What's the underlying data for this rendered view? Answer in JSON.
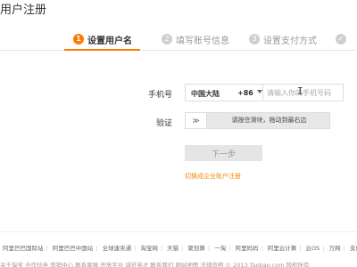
{
  "header": {
    "title": "用户注册"
  },
  "steps": [
    {
      "num": "1",
      "label": "设置用户名"
    },
    {
      "num": "2",
      "label": "填写账号信息"
    },
    {
      "num": "3",
      "label": "设置支付方式"
    }
  ],
  "form": {
    "phone_label": "手机号",
    "region": "中国大陆",
    "prefix": "+86",
    "phone_placeholder": "请输入你的手机号码",
    "verify_label": "验证",
    "slider_handle": "≫",
    "slider_text": "请按住滑块，拖动到最右边",
    "next_button": "下一步",
    "business_link": "切换成企业账户注册"
  },
  "footer": {
    "links": [
      "阿里巴巴国际站",
      "阿里巴巴中国站",
      "全球速卖通",
      "淘宝网",
      "天猫",
      "聚划算",
      "一淘",
      "阿里妈妈",
      "阿里云计算",
      "云OS",
      "万网",
      "支付宝"
    ],
    "bottom": "关于淘宝  合作伙伴  营销中心  联系客服  开放平台  诚征英才  联系我们  网站地图  法律声明  © 2013 Taobao.com 版权所有"
  },
  "colors": {
    "accent": "#ff7a00",
    "link": "#f08a00"
  }
}
